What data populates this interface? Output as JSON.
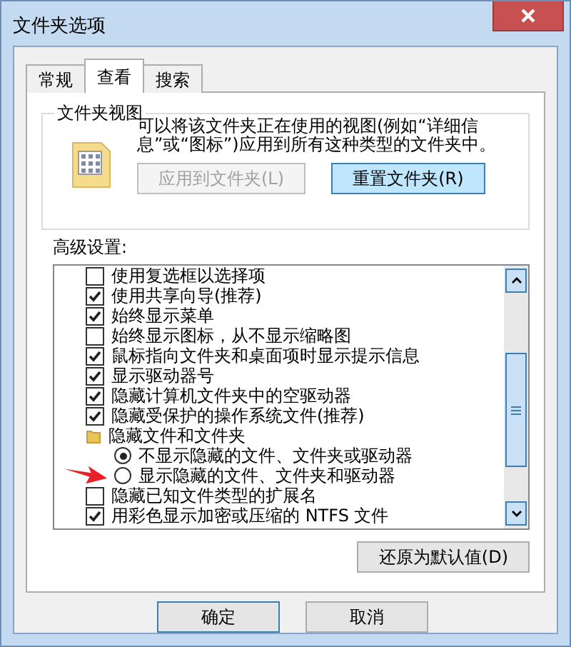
{
  "window": {
    "title": "文件夹选项"
  },
  "tabs": [
    {
      "label": "常规",
      "selected": false
    },
    {
      "label": "查看",
      "selected": true
    },
    {
      "label": "搜索",
      "selected": false
    }
  ],
  "folder_views": {
    "title": "文件夹视图",
    "description": "可以将该文件夹正在使用的视图(例如“详细信息”或“图标”)应用到所有这种类型的文件夹中。",
    "buttons": [
      {
        "label": "应用到文件夹(L)",
        "disabled": true
      },
      {
        "label": "重置文件夹(R)",
        "disabled": false
      }
    ]
  },
  "advanced": {
    "label": "高级设置:",
    "items": [
      {
        "kind": "checkbox",
        "label": "使用复选框以选择项",
        "checked": false
      },
      {
        "kind": "checkbox",
        "label": "使用共享向导(推荐)",
        "checked": true
      },
      {
        "kind": "checkbox",
        "label": "始终显示菜单",
        "checked": true
      },
      {
        "kind": "checkbox",
        "label": "始终显示图标，从不显示缩略图",
        "checked": false
      },
      {
        "kind": "checkbox",
        "label": "鼠标指向文件夹和桌面项时显示提示信息",
        "checked": true
      },
      {
        "kind": "checkbox",
        "label": "显示驱动器号",
        "checked": true
      },
      {
        "kind": "checkbox",
        "label": "隐藏计算机文件夹中的空驱动器",
        "checked": true
      },
      {
        "kind": "checkbox",
        "label": "隐藏受保护的操作系统文件(推荐)",
        "checked": true
      },
      {
        "kind": "folder",
        "label": "隐藏文件和文件夹",
        "children": [
          {
            "kind": "radio",
            "label": "不显示隐藏的文件、文件夹或驱动器",
            "selected": true
          },
          {
            "kind": "radio",
            "label": "显示隐藏的文件、文件夹和驱动器",
            "selected": false
          }
        ]
      },
      {
        "kind": "checkbox",
        "label": "隐藏已知文件类型的扩展名",
        "checked": false
      },
      {
        "kind": "checkbox",
        "label": "用彩色显示加密或压缩的 NTFS 文件",
        "checked": true
      }
    ],
    "restore_button": "还原为默认值(D)"
  },
  "buttons": [
    "确定",
    "取消"
  ]
}
